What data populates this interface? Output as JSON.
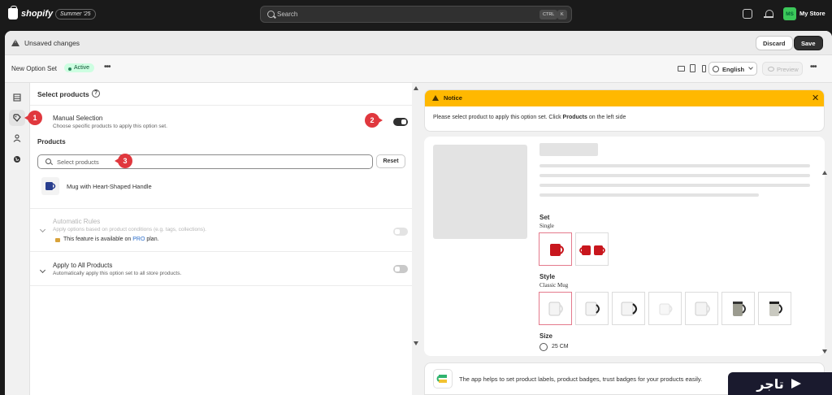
{
  "topbar": {
    "logo_text": "shopify",
    "edition_badge": "Summer '25",
    "search_placeholder": "Search",
    "shortcut_key1": "CTRL",
    "shortcut_key2": "K",
    "avatar_initials": "MS",
    "store_name": "My Store"
  },
  "unsaved_bar": {
    "message": "Unsaved changes",
    "discard_label": "Discard",
    "save_label": "Save"
  },
  "subheader": {
    "title": "New Option Set",
    "status": "Active",
    "more_label": "•••",
    "language": "English",
    "preview_label": "Preview"
  },
  "rail": {
    "items": [
      "layout-icon",
      "tag-icon",
      "person-icon",
      "globe-icon"
    ],
    "active_index": 1
  },
  "left_panel": {
    "title": "Select products",
    "manual": {
      "title": "Manual Selection",
      "description": "Choose specific products to apply this option set.",
      "enabled": true
    },
    "products_label": "Products",
    "search_placeholder": "Select products",
    "reset_label": "Reset",
    "products": [
      {
        "name": "Mug with Heart-Shaped Handle"
      }
    ],
    "automatic": {
      "title": "Automatic Rules",
      "description": "Apply options based on product conditions (e.g. tags, collections).",
      "plan_prefix": "This feature is available on",
      "plan_name": "PRO",
      "plan_suffix": "plan.",
      "enabled": false
    },
    "all_products": {
      "title": "Apply to All Products",
      "description": "Automatically apply this option set to all store products.",
      "enabled": false
    }
  },
  "callouts": [
    "1",
    "2",
    "3"
  ],
  "notice": {
    "title": "Notice",
    "body_prefix": "Please select product to apply this option set. Click",
    "body_bold": "Products",
    "body_suffix": "on the left side",
    "close_label": "✕"
  },
  "preview": {
    "set_label": "Set",
    "set_value": "Single",
    "style_label": "Style",
    "style_value": "Classic Mug",
    "size_label": "Size",
    "size_value": "25 CM"
  },
  "promo": {
    "text": "The app helps to set product labels, product badges, trust badges for your products easily."
  },
  "watermark": {
    "text": "تاجر"
  },
  "colors": {
    "accent_dark": "#303030",
    "active_green": "#29845a",
    "notice_yellow": "#ffb800",
    "callout_red": "#e0383e",
    "link_blue": "#2c6ecb"
  }
}
